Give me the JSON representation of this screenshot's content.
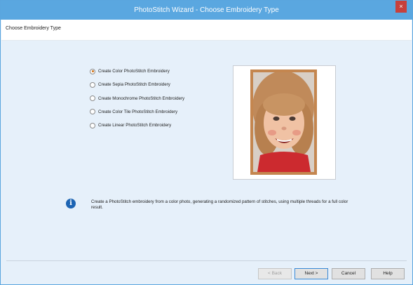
{
  "window": {
    "title": "PhotoStitch Wizard - Choose Embroidery Type",
    "close_glyph": "×"
  },
  "header": {
    "label": "Choose Embroidery Type"
  },
  "options": [
    {
      "label": "Create Color PhotoStitch Embroidery",
      "checked": true
    },
    {
      "label": "Create Sepia PhotoStitch Embroidery",
      "checked": false
    },
    {
      "label": "Create Monochrome PhotoStitch Embroidery",
      "checked": false
    },
    {
      "label": "Create Color Tile PhotoStitch Embroidery",
      "checked": false
    },
    {
      "label": "Create Linear PhotoStitch Embroidery",
      "checked": false
    }
  ],
  "info": {
    "icon": "info-icon",
    "glyph": "i",
    "text": "Create a PhotoStitch embroidery from a color photo, generating a randomized pattern of stitches, using multiple threads for a full color result."
  },
  "buttons": {
    "back": "< Back",
    "next": "Next >",
    "cancel": "Cancel",
    "help": "Help"
  },
  "colors": {
    "titlebar": "#5aa7e0",
    "close": "#c7403c",
    "frame": "#c4864f",
    "info": "#1d64b3",
    "radio_dot": "#d06f12"
  }
}
